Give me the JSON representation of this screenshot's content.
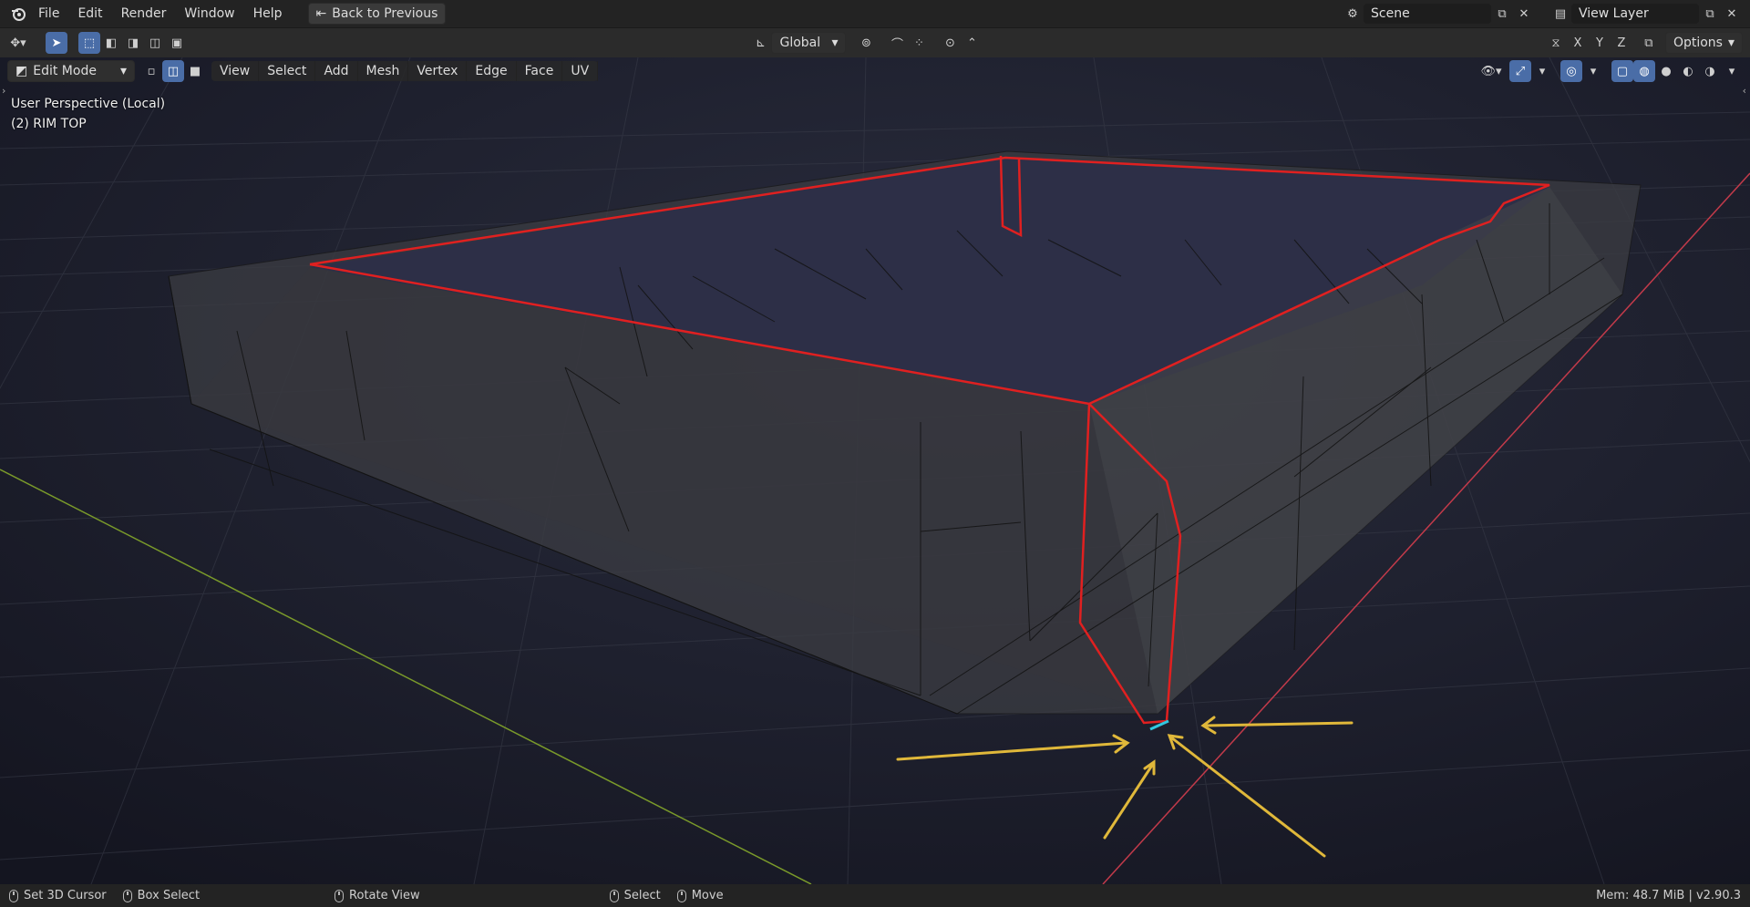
{
  "topbar": {
    "menus": [
      "File",
      "Edit",
      "Render",
      "Window",
      "Help"
    ],
    "back_button": "Back to Previous",
    "scene_name": "Scene",
    "view_layer": "View Layer"
  },
  "toolbar": {
    "transform_orientation": "Global",
    "axes": [
      "X",
      "Y",
      "Z"
    ],
    "options_label": "Options"
  },
  "viewport_header": {
    "mode": "Edit Mode",
    "menus": [
      "View",
      "Select",
      "Add",
      "Mesh",
      "Vertex",
      "Edge",
      "Face",
      "UV"
    ]
  },
  "viewport": {
    "perspective_label": "User Perspective (Local)",
    "object_label": "(2) RIM TOP"
  },
  "statusbar": {
    "items": [
      "Set 3D Cursor",
      "Box Select",
      "Rotate View",
      "Select",
      "Move"
    ],
    "memory": "Mem: 48.7 MiB | v2.90.3"
  },
  "colors": {
    "selected_edge": "#e02020",
    "active_edge": "#30c8e0",
    "arrow": "#e0b83a",
    "x_axis": "#c23a4a",
    "y_axis": "#7a9a2a"
  }
}
